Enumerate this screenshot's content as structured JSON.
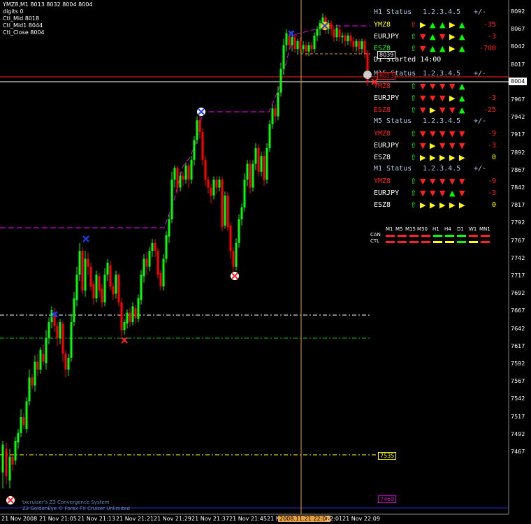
{
  "header": {
    "line1": "YMZ8,M1  8013 8032 8004 8004",
    "line2": "digits 0",
    "line3": "Ctl_Mid 8018",
    "line4": "Ctl_Mid1 8044",
    "line5": "Ctl_Close 8004"
  },
  "price_axis": [
    "8092",
    "8067",
    "8042",
    "8017",
    "7992",
    "7967",
    "7942",
    "7917",
    "7892",
    "7867",
    "7842",
    "7817",
    "7792",
    "7767",
    "7742",
    "7717",
    "7692",
    "7667",
    "7642",
    "7617",
    "7592",
    "7567",
    "7542",
    "7517",
    "7492",
    "7467"
  ],
  "price_box": "8004",
  "time_axis": [
    "21 Nov 2008",
    "21 Nov 21:05",
    "21 Nov 21:13",
    "21 Nov 21:21",
    "21 Nov 21:29",
    "21 Nov 21:37",
    "21 Nov 21:45",
    "21 N",
    "2008.11.21 22:00",
    "22:01",
    "21 Nov 22:09"
  ],
  "levels": {
    "l8039": "8039",
    "l7535": "7535",
    "l7469": "7469",
    "l8013": "8013"
  },
  "d1_started": "D1 Started 14:00",
  "colors": {
    "up": "#00ff00",
    "down": "#ff0000",
    "green": "#00ff00",
    "red": "#ff2020",
    "yellow": "#ffff00",
    "white": "#ffffff",
    "magenta": "#cc00cc"
  },
  "panels": [
    {
      "title": "H1 Status",
      "cols": "1.2.3.4.5",
      "pm": "+/-",
      "rows": [
        {
          "sym": "YMZ8",
          "c": "#ffff00",
          "a": [
            "R",
            "Y",
            "G",
            "G",
            "Y",
            "G"
          ],
          "v": "-35",
          "vc": "#ff2020"
        },
        {
          "sym": "EURJPY",
          "c": "#ffffff",
          "a": [
            "G",
            "R",
            "G",
            "R",
            "Y",
            "G"
          ],
          "v": "-3",
          "vc": "#ff2020"
        },
        {
          "sym": "ESZ8",
          "c": "#00ff00",
          "a": [
            "G",
            "R",
            "G",
            "G",
            "Y",
            "G"
          ],
          "v": "-700",
          "vc": "#ff2020"
        }
      ]
    },
    {
      "title": "M15 Status",
      "cols": "1.2.3.4.5",
      "pm": "+/-",
      "rows": [
        {
          "sym": "YMZ8",
          "c": "#ff2020",
          "a": [
            "G",
            "R",
            "R",
            "R",
            "R",
            "G"
          ],
          "v": "",
          "vc": "#ff2020"
        },
        {
          "sym": "EURJPY",
          "c": "#ffffff",
          "a": [
            "G",
            "R",
            "R",
            "R",
            "Y",
            "G"
          ],
          "v": "-3",
          "vc": "#ff2020"
        },
        {
          "sym": "ESZ8",
          "c": "#ff2020",
          "a": [
            "G",
            "R",
            "Y",
            "R",
            "R",
            "G"
          ],
          "v": "-25",
          "vc": "#ff2020"
        }
      ]
    },
    {
      "title": "M5 Status",
      "cols": "1.2.3.4.5",
      "pm": "+/-",
      "rows": [
        {
          "sym": "YMZ8",
          "c": "#ff2020",
          "a": [
            "G",
            "R",
            "R",
            "R",
            "R",
            "R"
          ],
          "v": "-9",
          "vc": "#ff2020"
        },
        {
          "sym": "EURJPY",
          "c": "#ffffff",
          "a": [
            "G",
            "R",
            "Y",
            "R",
            "R",
            "R"
          ],
          "v": "-3",
          "vc": "#ff2020"
        },
        {
          "sym": "ESZ8",
          "c": "#ffffff",
          "a": [
            "G",
            "Y",
            "Y",
            "Y",
            "Y",
            "Y"
          ],
          "v": "0",
          "vc": "#ffff00"
        }
      ]
    },
    {
      "title": "M1 Status",
      "cols": "1.2.3.4.5",
      "pm": "+/-",
      "rows": [
        {
          "sym": "YMZ8",
          "c": "#ff2020",
          "a": [
            "G",
            "R",
            "R",
            "R",
            "R",
            "R"
          ],
          "v": "-9",
          "vc": "#ff2020"
        },
        {
          "sym": "EURJPY",
          "c": "#ffffff",
          "a": [
            "G",
            "R",
            "R",
            "R",
            "G",
            "R"
          ],
          "v": "-3",
          "vc": "#ff2020"
        },
        {
          "sym": "ESZ8",
          "c": "#ffffff",
          "a": [
            "G",
            "Y",
            "Y",
            "Y",
            "Y",
            "Y"
          ],
          "v": "0",
          "vc": "#ffff00"
        }
      ]
    }
  ],
  "timeframes": [
    "M1",
    "M5",
    "M15",
    "M30",
    "H1",
    "H4",
    "D1",
    "W1",
    "MN1"
  ],
  "tf_rows": [
    {
      "label": "CAN",
      "colors": [
        "red",
        "red",
        "red",
        "red",
        "green",
        "green",
        "green",
        "red",
        "red"
      ]
    },
    {
      "label": "CTL",
      "colors": [
        "red",
        "red",
        "red",
        "red",
        "yellow",
        "yellow",
        "green",
        "yellow",
        "red"
      ]
    }
  ],
  "footer": {
    "line1": "txcruiser's Z3 Convergence System",
    "line2": "Z3 GoldenEye © Forex FX Cruiser Unlimited"
  }
}
